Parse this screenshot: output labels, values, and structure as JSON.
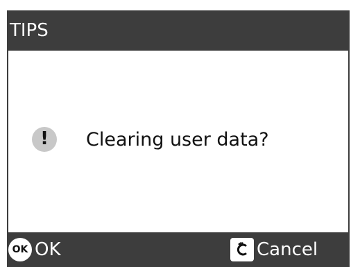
{
  "dialog": {
    "title": "TIPS",
    "message": "Clearing user data?",
    "icon": "exclamation-icon"
  },
  "softkeys": {
    "ok": {
      "badge": "OK",
      "label": "OK",
      "icon": "ok-key-icon"
    },
    "cancel": {
      "label": "Cancel",
      "icon": "back-arrow-icon"
    }
  },
  "colors": {
    "bar_background": "#3d3d3d",
    "body_background": "#ffffff",
    "icon_background": "#c8c8c8"
  }
}
